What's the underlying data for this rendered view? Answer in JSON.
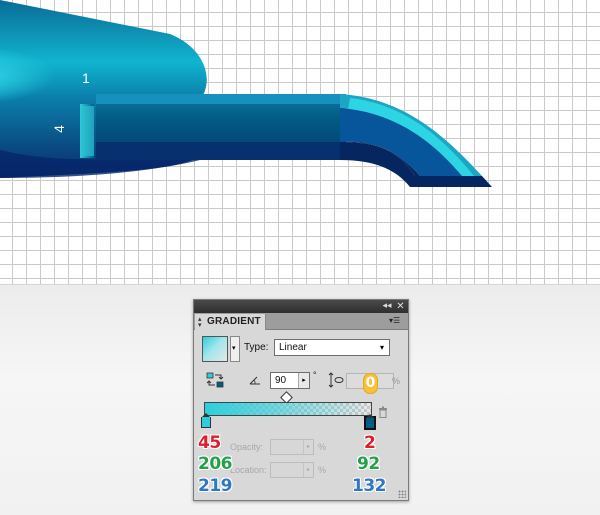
{
  "canvas": {
    "labels": {
      "top": "1",
      "side": "4"
    }
  },
  "panel": {
    "title": "GRADIENT",
    "type_label": "Type:",
    "type_value": "Linear",
    "angle_value": "90",
    "degree_symbol": "°",
    "aspect_percent": "%",
    "opacity_label": "Opacity:",
    "location_label": "Location:",
    "percent": "%",
    "collapse_glyph": "◂◂",
    "close_glyph": "✕",
    "menu_glyph": "▾☰",
    "dropdown_glyph": "▾",
    "stepper_glyph": "▸",
    "stops": [
      {
        "color": "#2dcedb",
        "r": "45",
        "g": "206",
        "b": "219"
      },
      {
        "color": "#025c84",
        "r": "2",
        "g": "92",
        "b": "132"
      }
    ],
    "aspect_badge": "0"
  },
  "colors": {
    "accent_red": "#e11d2b",
    "accent_green": "#22a14a",
    "accent_blue": "#2e76c6",
    "badge_orange": "#f5c23a"
  }
}
